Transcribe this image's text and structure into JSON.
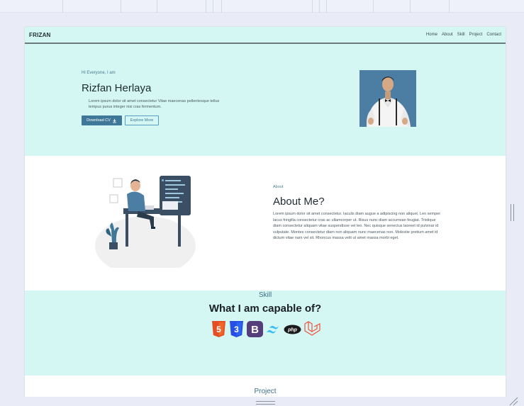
{
  "nav": {
    "brand": "FRIZAN",
    "links": [
      "Home",
      "About",
      "Skill",
      "Project",
      "Contact"
    ]
  },
  "hero": {
    "greeting": "Hi Everyone, I am",
    "name": "Rizfan Herlaya",
    "description": "Lorem ipsum dolor sit amet consectetur Vitae maecenas pellentesque tellus tempus purus integer nisi cras fermentum.",
    "download_label": "Download CV",
    "explore_label": "Explore More"
  },
  "about": {
    "tag": "About",
    "title": "About Me?",
    "text": "Lorem ipsum dolor sit amet consectetur. Iaculis diam augue a adipiscing non aliquet. Leo semper lacus fringilla consectetur cras ac ullamcorper ut. Risus nunc diam accumsan feugiat. Tristique diam consectetur aliquam vitae suspendisse vel leo. Nec quisque senectus laoreet id pulvinar id vulputate. Montes consectetur diam non aliquam nunc maecenas non. Molestie pretium amet id dictum vitae nam vel sit. Rhoncus massa velit ut amet massa morbi eget."
  },
  "skill": {
    "tag": "Skill",
    "title": "What I am capable of?",
    "icons": [
      {
        "name": "html5-icon",
        "label": "5",
        "color": "#e44d26"
      },
      {
        "name": "css3-icon",
        "label": "3",
        "color": "#264de4"
      },
      {
        "name": "bootstrap-icon",
        "label": "B",
        "color": "#563d7c"
      },
      {
        "name": "tailwind-icon",
        "label": "",
        "color": "#38bdf8"
      },
      {
        "name": "php-icon",
        "label": "php",
        "color": "#1a1a1a"
      },
      {
        "name": "laravel-icon",
        "label": "",
        "color": "#f05340"
      }
    ]
  },
  "project": {
    "tag": "Project"
  },
  "colors": {
    "accent": "#3e7797",
    "mint": "#d4f7f3"
  }
}
